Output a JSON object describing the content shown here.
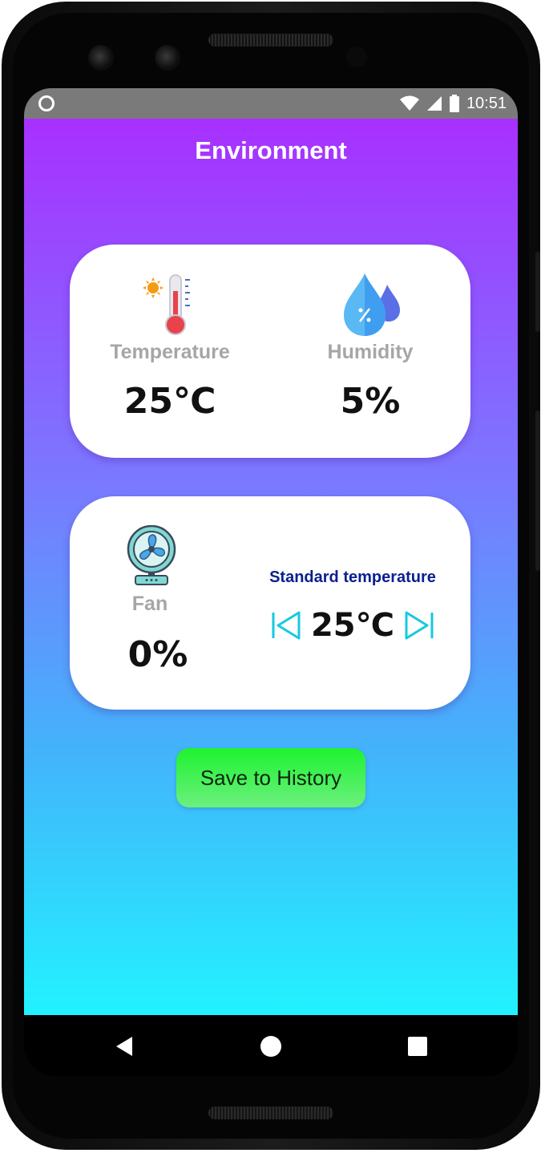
{
  "statusbar": {
    "time": "10:51"
  },
  "app": {
    "title": "Environment"
  },
  "sensors": {
    "temperature": {
      "label": "Temperature",
      "value": "25℃",
      "icon": "thermometer-icon"
    },
    "humidity": {
      "label": "Humidity",
      "value": "5%",
      "icon": "water-drops-icon"
    }
  },
  "fan": {
    "label": "Fan",
    "value": "0%",
    "icon": "fan-icon"
  },
  "standard_temperature": {
    "label": "Standard temperature",
    "value": "25℃"
  },
  "actions": {
    "save_label": "Save to History"
  },
  "colors": {
    "gradient_top": "#a830ff",
    "gradient_bottom": "#22f2ff",
    "save_button": "#1ef230",
    "stepper_accent": "#16c9e0",
    "standard_label": "#0a1f8f"
  }
}
